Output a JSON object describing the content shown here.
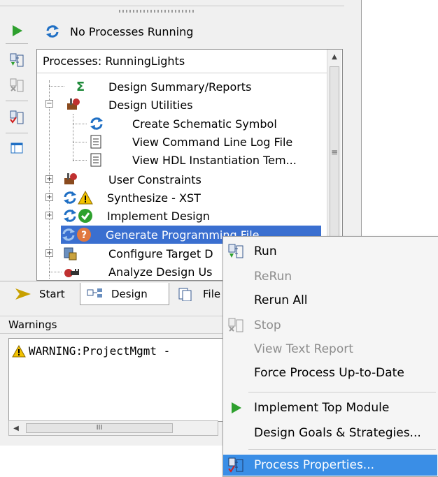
{
  "status": {
    "text": "No Processes Running"
  },
  "processes": {
    "header": "Processes: RunningLights",
    "items": [
      {
        "label": "Design Summary/Reports"
      },
      {
        "label": "Design Utilities"
      },
      {
        "label": "Create Schematic Symbol"
      },
      {
        "label": "View Command Line Log File"
      },
      {
        "label": "View HDL Instantiation Tem..."
      },
      {
        "label": "User Constraints"
      },
      {
        "label": "Synthesize - XST"
      },
      {
        "label": "Implement Design"
      },
      {
        "label": "Generate Programming File"
      },
      {
        "label": "Configure Target D"
      },
      {
        "label": "Analyze Design Us"
      }
    ]
  },
  "tabs": [
    {
      "label": "Start"
    },
    {
      "label": "Design"
    },
    {
      "label": "File"
    }
  ],
  "warnings": {
    "label": "Warnings",
    "lines": [
      "WARNING:ProjectMgmt -"
    ]
  },
  "scroll": {
    "grip_glyph": "III",
    "vgrip_glyph": "≡"
  },
  "context_menu": {
    "items": [
      {
        "label": "Run",
        "icon": "run-process-icon",
        "enabled": true
      },
      {
        "label": "ReRun",
        "enabled": false
      },
      {
        "label": "Rerun All",
        "enabled": true
      },
      {
        "label": "Stop",
        "icon": "stop-process-icon",
        "enabled": false
      },
      {
        "label": "View Text Report",
        "enabled": false
      },
      {
        "label": "Force Process Up-to-Date",
        "enabled": true
      },
      {
        "label": "Implement Top Module",
        "icon": "play-arrow-icon",
        "enabled": true
      },
      {
        "label": "Design Goals & Strategies...",
        "enabled": true
      },
      {
        "label": "Process Properties...",
        "icon": "process-properties-icon",
        "enabled": true,
        "highlighted": true
      }
    ]
  },
  "colors": {
    "selection": "#3a6fd0",
    "menu_highlight": "#3a8ee6",
    "green": "#2ea02e",
    "blue": "#1f6fc4"
  }
}
